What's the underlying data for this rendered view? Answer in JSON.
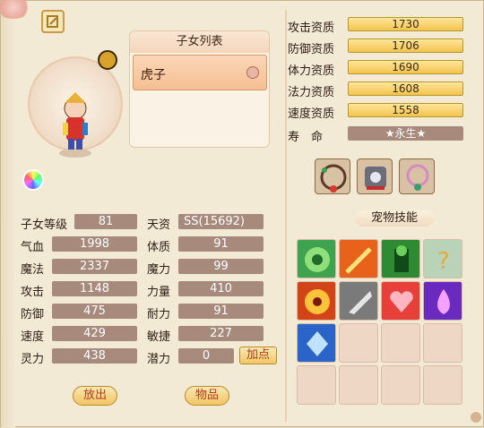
{
  "children_list": {
    "title": "子女列表",
    "items": [
      {
        "label": "虎子"
      }
    ]
  },
  "stats": {
    "rows": [
      {
        "label": "子女等级",
        "value": "81",
        "label2": "天资",
        "value2": "SS(15692)"
      },
      {
        "label": "气血",
        "value": "1998",
        "label2": "体质",
        "value2": "91"
      },
      {
        "label": "魔法",
        "value": "2337",
        "label2": "魔力",
        "value2": "99"
      },
      {
        "label": "攻击",
        "value": "1148",
        "label2": "力量",
        "value2": "410"
      },
      {
        "label": "防御",
        "value": "475",
        "label2": "耐力",
        "value2": "91"
      },
      {
        "label": "速度",
        "value": "429",
        "label2": "敏捷",
        "value2": "227"
      },
      {
        "label": "灵力",
        "value": "438",
        "label2": "潜力",
        "value2": "0"
      }
    ],
    "add_points": "加点"
  },
  "buttons": {
    "release": "放出",
    "items": "物品"
  },
  "aptitude": [
    {
      "label": "攻击资质",
      "value": "1730"
    },
    {
      "label": "防御资质",
      "value": "1706"
    },
    {
      "label": "体力资质",
      "value": "1690"
    },
    {
      "label": "法力资质",
      "value": "1608"
    },
    {
      "label": "速度资质",
      "value": "1558"
    }
  ],
  "life": {
    "label": "寿　命",
    "value": "★永生★"
  },
  "skills": {
    "title": "宠物技能"
  },
  "colors": {
    "stat_box": "#a88a7d",
    "aptitude_bar": "#f3c34e",
    "button_text": "#b0401a"
  }
}
